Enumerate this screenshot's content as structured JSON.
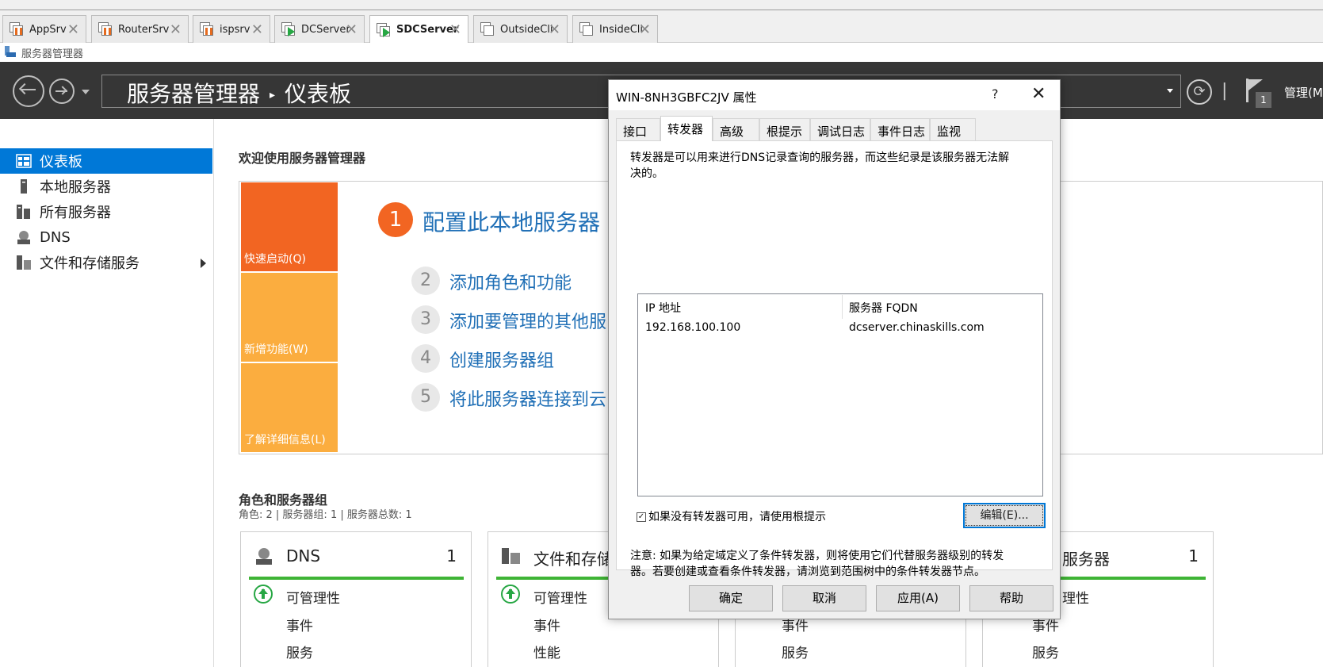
{
  "vm_tabs": [
    {
      "label": "AppSrv",
      "active": false,
      "running": false
    },
    {
      "label": "RouterSrv",
      "active": false,
      "running": false
    },
    {
      "label": "ispsrv",
      "active": false,
      "running": false
    },
    {
      "label": "DCServer",
      "active": false,
      "running": true
    },
    {
      "label": "SDCServer",
      "active": true,
      "running": true
    },
    {
      "label": "OutsideCli",
      "active": false,
      "running": false
    },
    {
      "label": "InsideCli",
      "active": false,
      "running": false
    }
  ],
  "app": {
    "title": "服务器管理器"
  },
  "header": {
    "breadcrumb_root": "服务器管理器",
    "breadcrumb_separator": "▸",
    "breadcrumb_page": "仪表板",
    "notification_count": "1",
    "manage_label": "管理(M"
  },
  "sidebar": {
    "items": [
      {
        "label": "仪表板",
        "active": true,
        "icon": "dashboard-icon"
      },
      {
        "label": "本地服务器",
        "active": false,
        "icon": "local-server-icon"
      },
      {
        "label": "所有服务器",
        "active": false,
        "icon": "all-servers-icon"
      },
      {
        "label": "DNS",
        "active": false,
        "icon": "dns-icon"
      },
      {
        "label": "文件和存储服务",
        "active": false,
        "icon": "file-storage-icon",
        "has_submenu": true
      }
    ]
  },
  "main": {
    "welcome_title": "欢迎使用服务器管理器",
    "quick_tiles": [
      {
        "label": "快速启动(Q)",
        "color": "#f26522"
      },
      {
        "label": "新增功能(W)",
        "color": "#fbad3f"
      },
      {
        "label": "了解详细信息(L)",
        "color": "#fbad3f"
      }
    ],
    "steps": [
      {
        "num": "1",
        "label": "配置此本地服务器"
      },
      {
        "num": "2",
        "label": "添加角色和功能"
      },
      {
        "num": "3",
        "label": "添加要管理的其他服"
      },
      {
        "num": "4",
        "label": "创建服务器组"
      },
      {
        "num": "5",
        "label": "将此服务器连接到云"
      }
    ],
    "roles_title": "角色和服务器组",
    "roles_subtitle": "角色: 2 | 服务器组: 1 | 服务器总数: 1",
    "role_cards": [
      {
        "name": "DNS",
        "count": "1",
        "lines": [
          "可管理性",
          "事件",
          "服务"
        ]
      },
      {
        "name": "文件和存储",
        "count": "",
        "lines": [
          "可管理性",
          "事件",
          "性能"
        ]
      },
      {
        "name": "",
        "count": "",
        "lines": [
          "",
          "事件",
          "服务"
        ]
      },
      {
        "name": "服务器",
        "count": "1",
        "lines": [
          "理性",
          "事件",
          "服务"
        ]
      }
    ]
  },
  "dialog": {
    "title": "WIN-8NH3GBFC2JV 属性",
    "help": "?",
    "tabs": [
      "接口",
      "转发器",
      "高级",
      "根提示",
      "调试日志",
      "事件日志",
      "监视"
    ],
    "active_tab": "转发器",
    "description_line1": "转发器是可以用来进行DNS记录查询的服务器，而这些纪录是该服务器无法解",
    "description_line2": "决的。",
    "list_headers": {
      "ip": "IP 地址",
      "fqdn": "服务器 FQDN"
    },
    "forwarders": [
      {
        "ip": "192.168.100.100",
        "fqdn": "dcserver.chinaskills.com"
      }
    ],
    "use_root_hints_label": "如果没有转发器可用，请使用根提示",
    "use_root_hints_checked": true,
    "edit_button": "编辑(E)...",
    "note_line1": "注意: 如果为给定域定义了条件转发器，则将使用它们代替服务器级别的转发",
    "note_line2": "器。若要创建或查看条件转发器，请浏览到范围树中的条件转发器节点。",
    "buttons": {
      "ok": "确定",
      "cancel": "取消",
      "apply": "应用(A)",
      "help": "帮助"
    }
  },
  "colors": {
    "accent": "#0078d7",
    "header_bg": "#363636",
    "link": "#1f6fb6",
    "status_green": "#3fb435"
  }
}
